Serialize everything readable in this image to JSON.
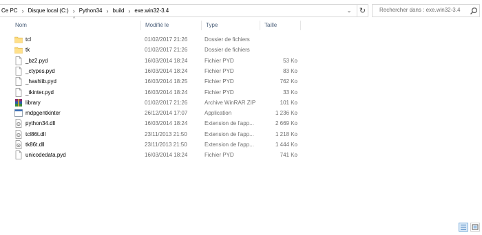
{
  "address": {
    "crumbs": [
      "Ce PC",
      "Disque local (C:)",
      "Python34",
      "build",
      "exe.win32-3.4"
    ]
  },
  "search": {
    "placeholder": "Rechercher dans : exe.win32-3.4"
  },
  "columns": {
    "name": "Nom",
    "modified": "Modifié le",
    "type": "Type",
    "size": "Taille"
  },
  "files": [
    {
      "icon": "folder-icon",
      "name": "tcl",
      "modified": "01/02/2017 21:26",
      "type": "Dossier de fichiers",
      "size": ""
    },
    {
      "icon": "folder-icon",
      "name": "tk",
      "modified": "01/02/2017 21:26",
      "type": "Dossier de fichiers",
      "size": ""
    },
    {
      "icon": "file-icon",
      "name": "_bz2.pyd",
      "modified": "16/03/2014 18:24",
      "type": "Fichier PYD",
      "size": "53 Ko"
    },
    {
      "icon": "file-icon",
      "name": "_ctypes.pyd",
      "modified": "16/03/2014 18:24",
      "type": "Fichier PYD",
      "size": "83 Ko"
    },
    {
      "icon": "file-icon",
      "name": "_hashlib.pyd",
      "modified": "16/03/2014 18:25",
      "type": "Fichier PYD",
      "size": "762 Ko"
    },
    {
      "icon": "file-icon",
      "name": "_tkinter.pyd",
      "modified": "16/03/2014 18:24",
      "type": "Fichier PYD",
      "size": "33 Ko"
    },
    {
      "icon": "winrar-icon",
      "name": "library",
      "modified": "01/02/2017 21:26",
      "type": "Archive WinRAR ZIP",
      "size": "101 Ko"
    },
    {
      "icon": "application-icon",
      "name": "mdpgentkinter",
      "modified": "26/12/2014 17:07",
      "type": "Application",
      "size": "1 236 Ko"
    },
    {
      "icon": "dll-icon",
      "name": "python34.dll",
      "modified": "16/03/2014 18:24",
      "type": "Extension de l'app...",
      "size": "2 669 Ko"
    },
    {
      "icon": "dll-icon",
      "name": "tcl86t.dll",
      "modified": "23/11/2013 21:50",
      "type": "Extension de l'app...",
      "size": "1 218 Ko"
    },
    {
      "icon": "dll-icon",
      "name": "tk86t.dll",
      "modified": "23/11/2013 21:50",
      "type": "Extension de l'app...",
      "size": "1 444 Ko"
    },
    {
      "icon": "file-icon",
      "name": "unicodedata.pyd",
      "modified": "16/03/2014 18:24",
      "type": "Fichier PYD",
      "size": "741 Ko"
    }
  ],
  "colors": {
    "folder": "#f8d775",
    "header_text": "#4c607a",
    "meta_text": "#6d6d6d",
    "accent": "#3c8fd8"
  }
}
